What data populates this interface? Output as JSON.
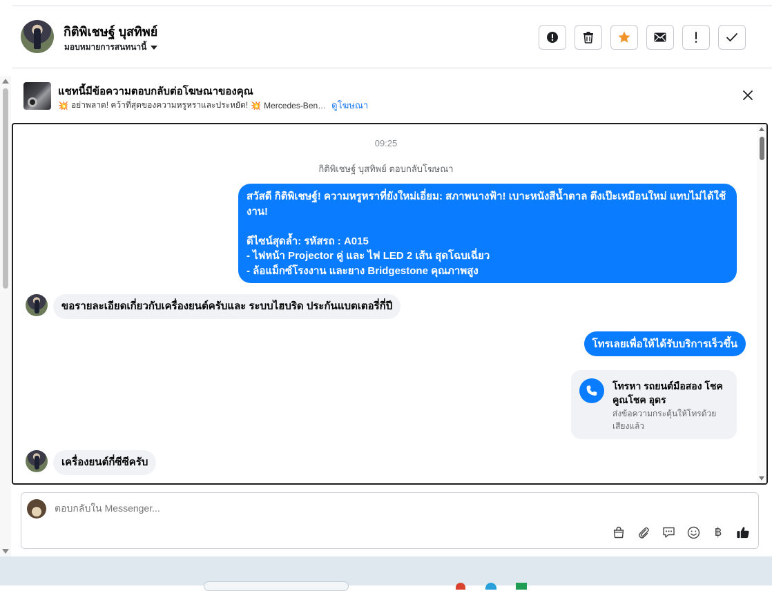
{
  "header": {
    "contact_name": "กิติพิเชษฐ์ บุสทิพย์",
    "assign_label": "มอบหมายการสนทนานี้",
    "actions": [
      {
        "name": "report-spam-button",
        "icon": "exclamation-circle-icon"
      },
      {
        "name": "delete-button",
        "icon": "trash-icon"
      },
      {
        "name": "star-button",
        "icon": "star-icon"
      },
      {
        "name": "mark-unread-button",
        "icon": "envelope-icon"
      },
      {
        "name": "follow-up-button",
        "icon": "exclamation-icon"
      },
      {
        "name": "mark-done-button",
        "icon": "checkmark-icon"
      }
    ],
    "star_color": "#f0932b"
  },
  "ad": {
    "title": "แชทนี้มีข้อความตอบกลับต่อโฆษณาของคุณ",
    "spark": "💥",
    "preview_text": "อย่าพลาด! คว้าที่สุดของความหรูหราและประหยัด!",
    "preview_brand": "Mercedes-Ben…",
    "view_ad_link": "ดูโฆษณา"
  },
  "chat": {
    "timestamp": "09:25",
    "replied_note": "กิติพิเชษฐ์ บุสทิพย์ ตอบกลับโฆษณา",
    "msg_ad_line1": "สวัสดี กิติพิเชษฐ์! ความหรูหราที่ยังใหม่เอี่ยม: สภาพนางฟ้า! เบาะหนังสีน้ำตาล ตึงเป๊ะเหมือนใหม่ แทบไม่ได้ใช้งาน!",
    "msg_ad_line2": "ดีไซน์สุดล้ำ: รหัสรถ : A015",
    "msg_ad_line3": "- ไฟหน้า Projector คู่ และ ไฟ LED 2 เส้น สุดโฉบเฉี่ยว",
    "msg_ad_line4": "- ล้อแม็กซ์โรงงาน และยาง Bridgestone คุณภาพสูง",
    "msg_in_1": "ขอรายละเอียดเกี่ยวกับเครื่องยนต์ครับและ ระบบไฮบริด ประกันแบตเตอรี่กี่ปี",
    "msg_out_2": "โทรเลยเพื่อให้ได้รับบริการเร็วขึ้น",
    "call_title": "โทรหา รถยนต์มือสอง โชคคูณโชค อุดร",
    "call_sub": "ส่งข้อความกระตุ้นให้โทรด้วยเสียงแล้ว",
    "msg_in_2": "เครื่องยนต์กี่ซีซีครับ",
    "outgoing_color": "#0a7cff"
  },
  "composer": {
    "placeholder": "ตอบกลับใน Messenger...",
    "tools": [
      "bag-icon",
      "paperclip-icon",
      "saved-reply-icon",
      "emoji-icon",
      "baht-icon",
      "thumbs-up-icon"
    ],
    "baht_symbol": "฿"
  }
}
